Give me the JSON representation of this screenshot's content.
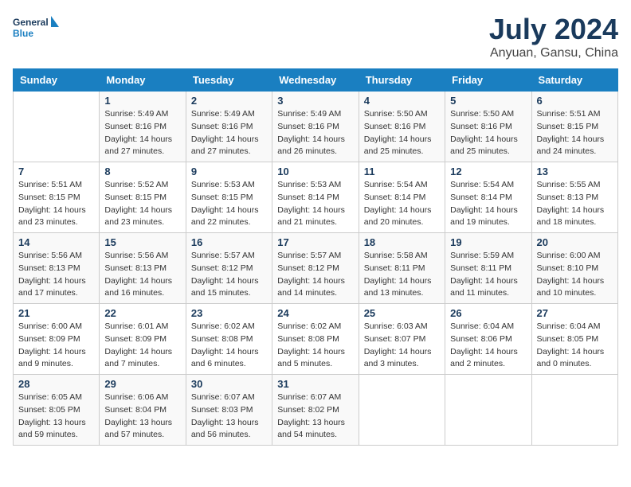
{
  "header": {
    "logo_line1": "General",
    "logo_line2": "Blue",
    "month": "July 2024",
    "location": "Anyuan, Gansu, China"
  },
  "days_of_week": [
    "Sunday",
    "Monday",
    "Tuesday",
    "Wednesday",
    "Thursday",
    "Friday",
    "Saturday"
  ],
  "weeks": [
    [
      {
        "num": "",
        "info": ""
      },
      {
        "num": "1",
        "info": "Sunrise: 5:49 AM\nSunset: 8:16 PM\nDaylight: 14 hours\nand 27 minutes."
      },
      {
        "num": "2",
        "info": "Sunrise: 5:49 AM\nSunset: 8:16 PM\nDaylight: 14 hours\nand 27 minutes."
      },
      {
        "num": "3",
        "info": "Sunrise: 5:49 AM\nSunset: 8:16 PM\nDaylight: 14 hours\nand 26 minutes."
      },
      {
        "num": "4",
        "info": "Sunrise: 5:50 AM\nSunset: 8:16 PM\nDaylight: 14 hours\nand 25 minutes."
      },
      {
        "num": "5",
        "info": "Sunrise: 5:50 AM\nSunset: 8:16 PM\nDaylight: 14 hours\nand 25 minutes."
      },
      {
        "num": "6",
        "info": "Sunrise: 5:51 AM\nSunset: 8:15 PM\nDaylight: 14 hours\nand 24 minutes."
      }
    ],
    [
      {
        "num": "7",
        "info": "Sunrise: 5:51 AM\nSunset: 8:15 PM\nDaylight: 14 hours\nand 23 minutes."
      },
      {
        "num": "8",
        "info": "Sunrise: 5:52 AM\nSunset: 8:15 PM\nDaylight: 14 hours\nand 23 minutes."
      },
      {
        "num": "9",
        "info": "Sunrise: 5:53 AM\nSunset: 8:15 PM\nDaylight: 14 hours\nand 22 minutes."
      },
      {
        "num": "10",
        "info": "Sunrise: 5:53 AM\nSunset: 8:14 PM\nDaylight: 14 hours\nand 21 minutes."
      },
      {
        "num": "11",
        "info": "Sunrise: 5:54 AM\nSunset: 8:14 PM\nDaylight: 14 hours\nand 20 minutes."
      },
      {
        "num": "12",
        "info": "Sunrise: 5:54 AM\nSunset: 8:14 PM\nDaylight: 14 hours\nand 19 minutes."
      },
      {
        "num": "13",
        "info": "Sunrise: 5:55 AM\nSunset: 8:13 PM\nDaylight: 14 hours\nand 18 minutes."
      }
    ],
    [
      {
        "num": "14",
        "info": "Sunrise: 5:56 AM\nSunset: 8:13 PM\nDaylight: 14 hours\nand 17 minutes."
      },
      {
        "num": "15",
        "info": "Sunrise: 5:56 AM\nSunset: 8:13 PM\nDaylight: 14 hours\nand 16 minutes."
      },
      {
        "num": "16",
        "info": "Sunrise: 5:57 AM\nSunset: 8:12 PM\nDaylight: 14 hours\nand 15 minutes."
      },
      {
        "num": "17",
        "info": "Sunrise: 5:57 AM\nSunset: 8:12 PM\nDaylight: 14 hours\nand 14 minutes."
      },
      {
        "num": "18",
        "info": "Sunrise: 5:58 AM\nSunset: 8:11 PM\nDaylight: 14 hours\nand 13 minutes."
      },
      {
        "num": "19",
        "info": "Sunrise: 5:59 AM\nSunset: 8:11 PM\nDaylight: 14 hours\nand 11 minutes."
      },
      {
        "num": "20",
        "info": "Sunrise: 6:00 AM\nSunset: 8:10 PM\nDaylight: 14 hours\nand 10 minutes."
      }
    ],
    [
      {
        "num": "21",
        "info": "Sunrise: 6:00 AM\nSunset: 8:09 PM\nDaylight: 14 hours\nand 9 minutes."
      },
      {
        "num": "22",
        "info": "Sunrise: 6:01 AM\nSunset: 8:09 PM\nDaylight: 14 hours\nand 7 minutes."
      },
      {
        "num": "23",
        "info": "Sunrise: 6:02 AM\nSunset: 8:08 PM\nDaylight: 14 hours\nand 6 minutes."
      },
      {
        "num": "24",
        "info": "Sunrise: 6:02 AM\nSunset: 8:08 PM\nDaylight: 14 hours\nand 5 minutes."
      },
      {
        "num": "25",
        "info": "Sunrise: 6:03 AM\nSunset: 8:07 PM\nDaylight: 14 hours\nand 3 minutes."
      },
      {
        "num": "26",
        "info": "Sunrise: 6:04 AM\nSunset: 8:06 PM\nDaylight: 14 hours\nand 2 minutes."
      },
      {
        "num": "27",
        "info": "Sunrise: 6:04 AM\nSunset: 8:05 PM\nDaylight: 14 hours\nand 0 minutes."
      }
    ],
    [
      {
        "num": "28",
        "info": "Sunrise: 6:05 AM\nSunset: 8:05 PM\nDaylight: 13 hours\nand 59 minutes."
      },
      {
        "num": "29",
        "info": "Sunrise: 6:06 AM\nSunset: 8:04 PM\nDaylight: 13 hours\nand 57 minutes."
      },
      {
        "num": "30",
        "info": "Sunrise: 6:07 AM\nSunset: 8:03 PM\nDaylight: 13 hours\nand 56 minutes."
      },
      {
        "num": "31",
        "info": "Sunrise: 6:07 AM\nSunset: 8:02 PM\nDaylight: 13 hours\nand 54 minutes."
      },
      {
        "num": "",
        "info": ""
      },
      {
        "num": "",
        "info": ""
      },
      {
        "num": "",
        "info": ""
      }
    ]
  ]
}
